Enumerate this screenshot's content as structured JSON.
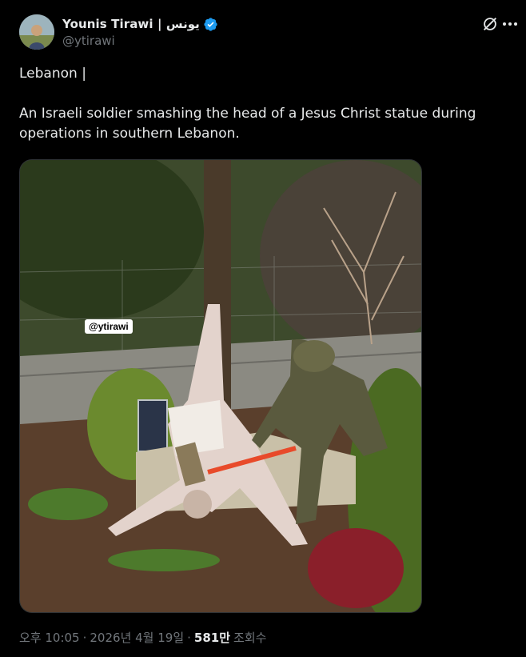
{
  "author": {
    "name": "Younis Tirawi | يونس",
    "handle": "@ytirawi",
    "verified": true,
    "verified_color": "#1d9bf0",
    "avatar_icon": "avatar-photo"
  },
  "header_actions": {
    "grok_icon": "grok-icon",
    "more_icon": "more-options-icon"
  },
  "tweet": {
    "line1": "Lebanon |",
    "line2": "An Israeli soldier smashing the head of a Jesus Christ statue during",
    "line3": "operations in southern Lebanon."
  },
  "media": {
    "watermark": "@ytirawi"
  },
  "meta": {
    "time": "오후 10:05",
    "date": "2026년 4월 19일",
    "separator": "·",
    "views_count": "581만",
    "views_label": "조회수"
  },
  "colors": {
    "background": "#000000",
    "primary_text": "#e7e9ea",
    "secondary_text": "#71767b",
    "border": "#2f3336"
  }
}
